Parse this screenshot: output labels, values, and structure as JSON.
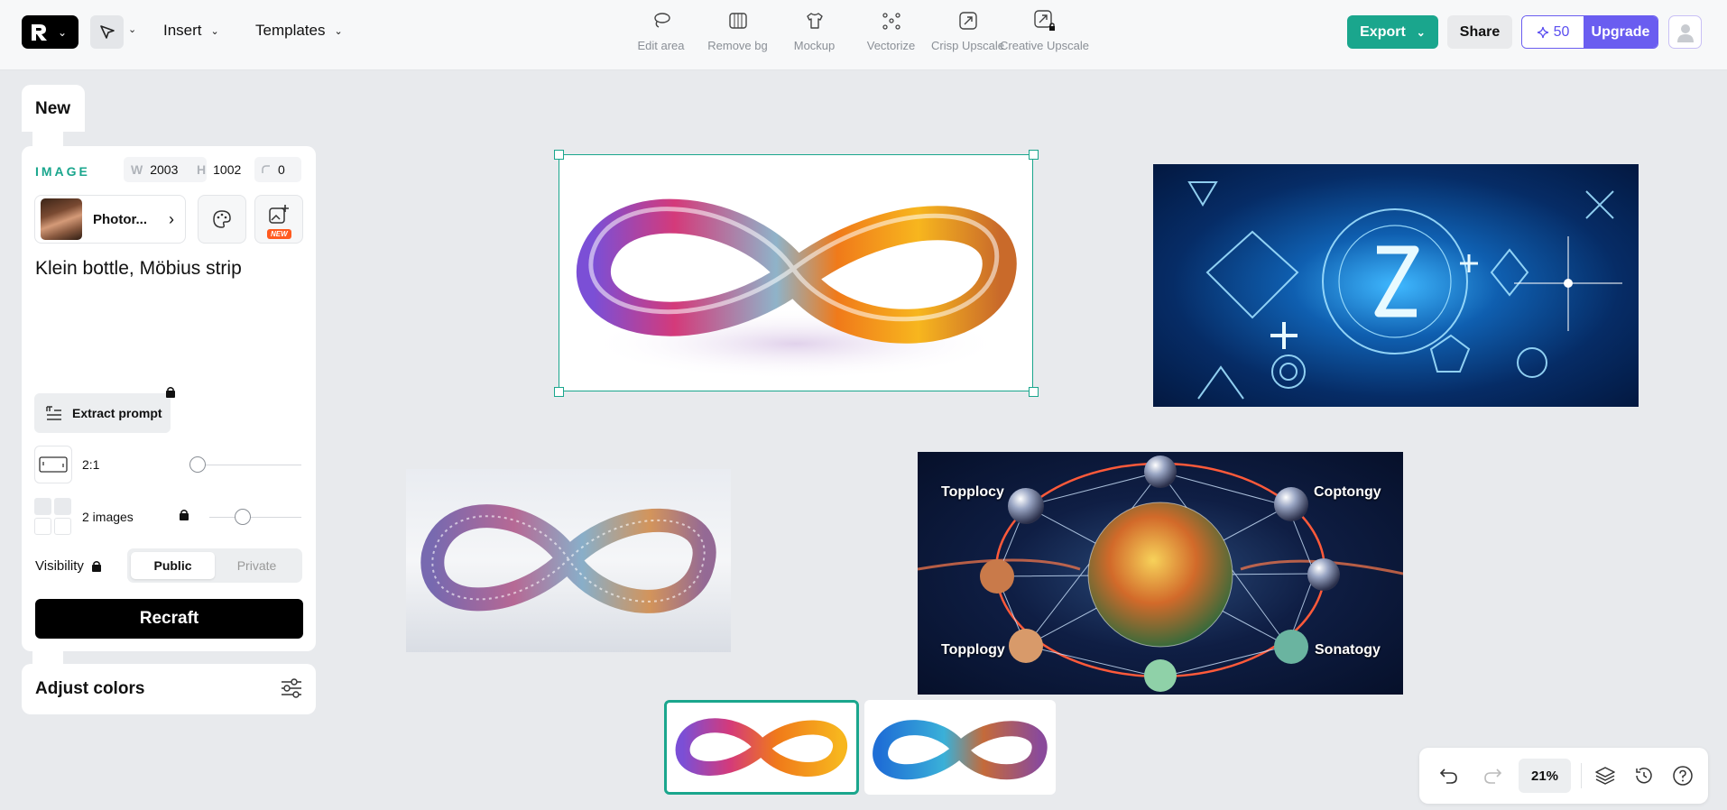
{
  "header": {
    "insert_label": "Insert",
    "templates_label": "Templates",
    "tools": [
      {
        "label": "Edit area",
        "icon": "lasso-icon"
      },
      {
        "label": "Remove bg",
        "icon": "remove-bg-icon"
      },
      {
        "label": "Mockup",
        "icon": "tshirt-icon"
      },
      {
        "label": "Vectorize",
        "icon": "vectorize-icon"
      },
      {
        "label": "Crisp Upscale",
        "icon": "upscale-icon"
      },
      {
        "label": "Creative Upscale",
        "icon": "creative-upscale-icon"
      }
    ],
    "export_label": "Export",
    "share_label": "Share",
    "credits": "50",
    "upgrade_label": "Upgrade"
  },
  "panel": {
    "tab_label": "New",
    "section_label": "IMAGE",
    "width_key": "W",
    "width": "2003",
    "height_key": "H",
    "height": "1002",
    "corner": "0",
    "style_name": "Photor...",
    "new_badge": "NEW",
    "prompt": "Klein bottle, Möbius strip",
    "extract_label": "Extract prompt",
    "ratio_label": "2:1",
    "count_label": "2 images",
    "visibility_label": "Visibility",
    "public_label": "Public",
    "private_label": "Private",
    "recraft_label": "Recraft",
    "adjust_label": "Adjust colors"
  },
  "canvas": {
    "planet_labels": [
      "Topplocy",
      "Coptongy",
      "Topplogy",
      "Sonatogy"
    ]
  },
  "zoom": "21%",
  "colors": {
    "accent": "#1aa68d",
    "upgrade": "#6a5df0"
  }
}
